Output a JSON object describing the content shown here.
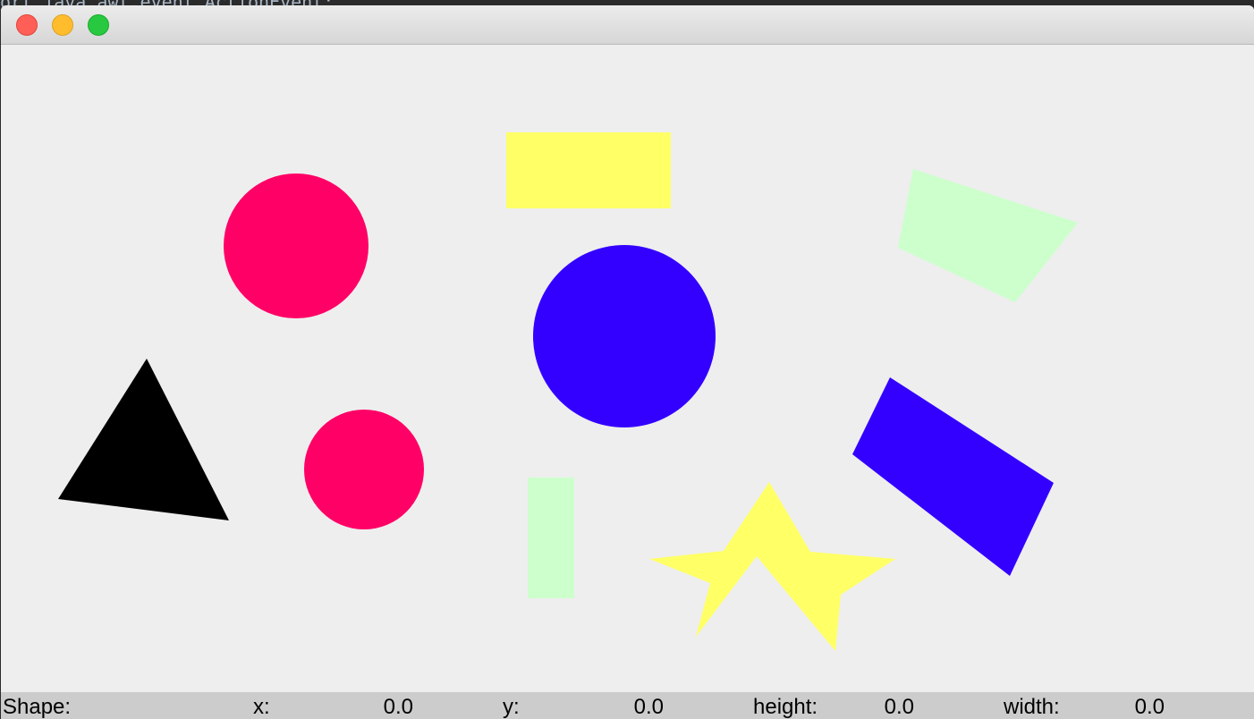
{
  "background_code": {
    "text": "ort java.awt.event.ActionEvent;"
  },
  "window": {
    "title": ""
  },
  "colors": {
    "pink": "#ff0066",
    "blue": "#3300ff",
    "yellow": "#ffff66",
    "mint": "#ccffcc",
    "black": "#000000",
    "canvas": "#eeeeee",
    "statusbar": "#cccccc"
  },
  "shapes": [
    {
      "kind": "circle",
      "name": "pink-circle-large",
      "color": "pink"
    },
    {
      "kind": "circle",
      "name": "pink-circle-small",
      "color": "pink"
    },
    {
      "kind": "circle",
      "name": "blue-circle",
      "color": "blue"
    },
    {
      "kind": "rectangle",
      "name": "yellow-rectangle",
      "color": "yellow"
    },
    {
      "kind": "rectangle",
      "name": "mint-rectangle-vertical",
      "color": "mint"
    },
    {
      "kind": "polygon",
      "name": "mint-quadrilateral",
      "color": "mint"
    },
    {
      "kind": "polygon",
      "name": "blue-rotated-rectangle",
      "color": "blue"
    },
    {
      "kind": "triangle",
      "name": "black-triangle",
      "color": "black"
    },
    {
      "kind": "star",
      "name": "yellow-star",
      "color": "yellow"
    }
  ],
  "status": {
    "shape_label": "Shape:",
    "shape_value": "",
    "x_label": "x:",
    "x_value": "0.0",
    "y_label": "y:",
    "y_value": "0.0",
    "height_label": "height:",
    "height_value": "0.0",
    "width_label": "width:",
    "width_value": "0.0"
  }
}
